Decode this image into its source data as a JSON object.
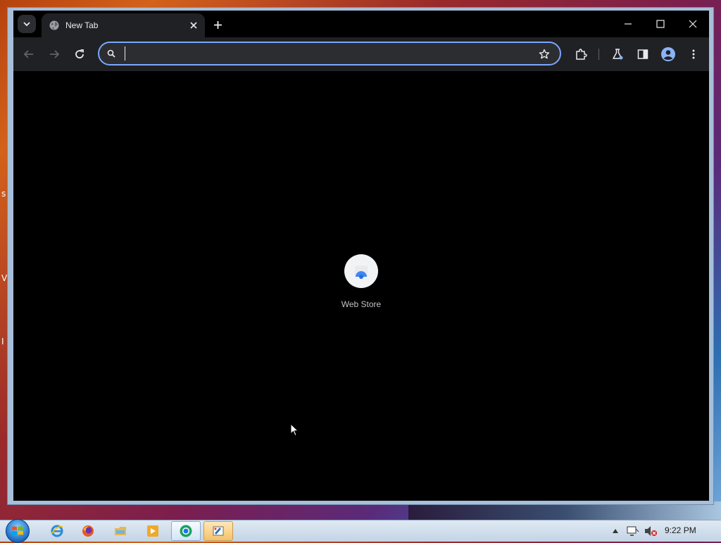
{
  "window": {
    "tab": {
      "title": "New Tab",
      "icon": "globe-icon"
    },
    "controls": {
      "minimize": "minimize-icon",
      "maximize": "maximize-icon",
      "close": "close-icon"
    }
  },
  "toolbar": {
    "omnibox": {
      "value": "",
      "placeholder": ""
    },
    "icons": [
      "back-icon",
      "forward-icon",
      "reload-icon",
      "search-icon",
      "star-icon",
      "extensions-icon",
      "labs-icon",
      "side-panel-icon",
      "profile-icon",
      "menu-icon"
    ]
  },
  "content": {
    "shortcuts": [
      {
        "label": "Web Store",
        "icon": "web-store-icon"
      }
    ]
  },
  "taskbar": {
    "apps": [
      "internet-explorer-icon",
      "firefox-icon",
      "file-explorer-icon",
      "media-player-icon",
      "chrome-icon",
      "paint-icon"
    ],
    "clock": "9:22 PM"
  },
  "desktop": {
    "edge_glyphs": [
      "s",
      "V",
      "I"
    ]
  },
  "colors": {
    "accent": "#7aa7ff",
    "toolbar": "#202124",
    "background": "#000000"
  }
}
